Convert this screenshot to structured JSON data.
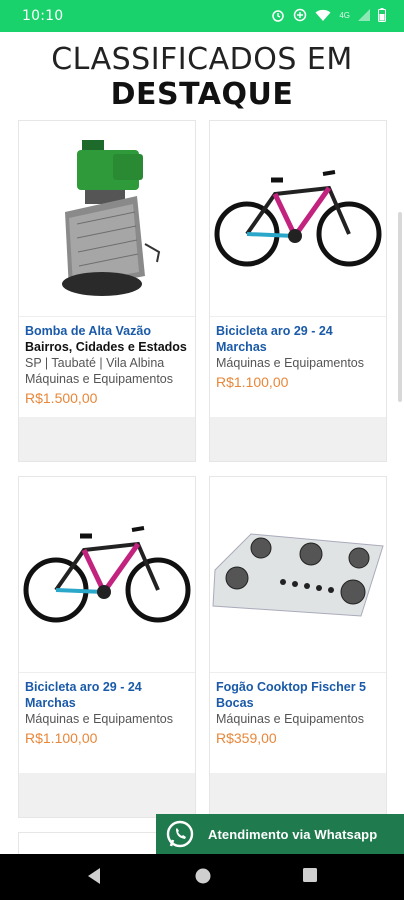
{
  "status_bar": {
    "time": "10:10",
    "network": "4G"
  },
  "heading": {
    "line1": "CLASSIFICADOS EM",
    "line2": "DESTAQUE"
  },
  "listings": [
    {
      "title": "Bomba de Alta Vazão",
      "location_title": "Bairros, Cidades e Estados",
      "location": "SP | Taubaté | Vila Albina",
      "category": "Máquinas e Equipamentos",
      "price": "R$1.500,00",
      "image": "water-pump-image"
    },
    {
      "title": "Bicicleta aro 29 - 24 Marchas",
      "category": "Máquinas e Equipamentos",
      "price": "R$1.100,00",
      "image": "bicycle-image"
    },
    {
      "title": "Bicicleta aro 29 - 24 Marchas",
      "category": "Máquinas e Equipamentos",
      "price": "R$1.100,00",
      "image": "bicycle-image"
    },
    {
      "title": "Fogão Cooktop Fischer 5 Bocas",
      "category": "Máquinas e Equipamentos",
      "price": "R$359,00",
      "image": "cooktop-image"
    }
  ],
  "whatsapp": {
    "label": "Atendimento via Whatsapp",
    "color": "#1f7a4d"
  },
  "colors": {
    "status_bar": "#19d26b",
    "title_link": "#1a5aa8",
    "price": "#e8873a"
  }
}
